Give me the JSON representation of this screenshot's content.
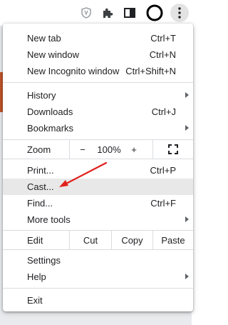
{
  "toolbar": {
    "icons": [
      "shield-icon",
      "puzzle-icon",
      "sidebar-icon",
      "profile-icon",
      "kebab-menu-icon"
    ]
  },
  "menu": {
    "new_tab": {
      "label": "New tab",
      "shortcut": "Ctrl+T"
    },
    "new_window": {
      "label": "New window",
      "shortcut": "Ctrl+N"
    },
    "new_incognito": {
      "label": "New Incognito window",
      "shortcut": "Ctrl+Shift+N"
    },
    "history": {
      "label": "History"
    },
    "downloads": {
      "label": "Downloads",
      "shortcut": "Ctrl+J"
    },
    "bookmarks": {
      "label": "Bookmarks"
    },
    "zoom": {
      "label": "Zoom",
      "minus": "−",
      "value": "100%",
      "plus": "+"
    },
    "print": {
      "label": "Print...",
      "shortcut": "Ctrl+P"
    },
    "cast": {
      "label": "Cast..."
    },
    "find": {
      "label": "Find...",
      "shortcut": "Ctrl+F"
    },
    "more_tools": {
      "label": "More tools"
    },
    "edit": {
      "label": "Edit",
      "cut": "Cut",
      "copy": "Copy",
      "paste": "Paste"
    },
    "settings": {
      "label": "Settings"
    },
    "help": {
      "label": "Help"
    },
    "exit": {
      "label": "Exit"
    }
  },
  "colors": {
    "highlight": "#e8e8e8",
    "annotation_arrow": "#e0201b",
    "separator": "#dadce0"
  }
}
